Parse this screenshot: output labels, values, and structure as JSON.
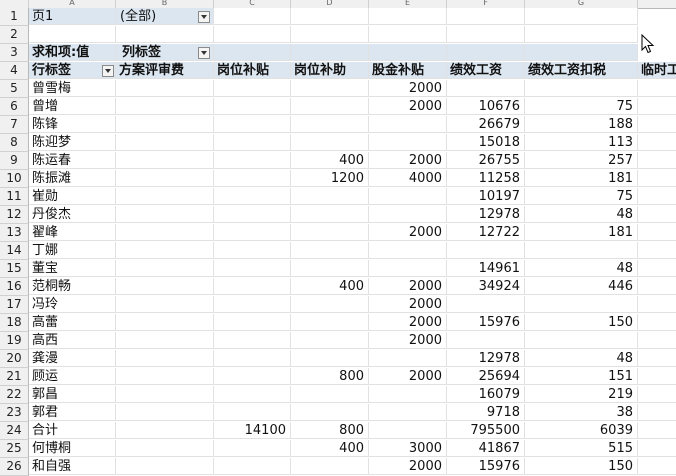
{
  "column_headers": [
    "A",
    "B",
    "C",
    "D",
    "E",
    "F",
    "G"
  ],
  "filter": {
    "field": "页1",
    "value": "(全部)"
  },
  "pivot": {
    "value_label": "求和项:值",
    "column_label": "列标签",
    "row_label": "行标签",
    "columns": [
      "方案评审费",
      "岗位补贴",
      "岗位补助",
      "股金补贴",
      "绩效工资",
      "绩效工资扣税",
      "临时工"
    ]
  },
  "row_numbers": [
    "1",
    "2",
    "3",
    "4",
    "5",
    "6",
    "7",
    "8",
    "9",
    "10",
    "11",
    "12",
    "13",
    "14",
    "15",
    "16",
    "17",
    "18",
    "19",
    "20",
    "21",
    "22",
    "23",
    "24",
    "25",
    "26"
  ],
  "rows": [
    {
      "name": "曾雪梅",
      "v": [
        "",
        "",
        "",
        "2000",
        "",
        "",
        ""
      ]
    },
    {
      "name": "曾增",
      "v": [
        "",
        "",
        "",
        "2000",
        "10676",
        "75",
        ""
      ]
    },
    {
      "name": "陈锋",
      "v": [
        "",
        "",
        "",
        "",
        "26679",
        "188",
        ""
      ]
    },
    {
      "name": "陈迎梦",
      "v": [
        "",
        "",
        "",
        "",
        "15018",
        "113",
        ""
      ]
    },
    {
      "name": "陈运春",
      "v": [
        "",
        "",
        "400",
        "2000",
        "26755",
        "257",
        ""
      ]
    },
    {
      "name": "陈振滩",
      "v": [
        "",
        "",
        "1200",
        "4000",
        "11258",
        "181",
        ""
      ]
    },
    {
      "name": "崔勋",
      "v": [
        "",
        "",
        "",
        "",
        "10197",
        "75",
        ""
      ]
    },
    {
      "name": "丹俊杰",
      "v": [
        "",
        "",
        "",
        "",
        "12978",
        "48",
        ""
      ]
    },
    {
      "name": "翟峰",
      "v": [
        "",
        "",
        "",
        "2000",
        "12722",
        "181",
        ""
      ]
    },
    {
      "name": "丁娜",
      "v": [
        "",
        "",
        "",
        "",
        "",
        "",
        ""
      ]
    },
    {
      "name": "董宝",
      "v": [
        "",
        "",
        "",
        "",
        "14961",
        "48",
        ""
      ]
    },
    {
      "name": "范桐畅",
      "v": [
        "",
        "",
        "400",
        "2000",
        "34924",
        "446",
        ""
      ]
    },
    {
      "name": "冯玲",
      "v": [
        "",
        "",
        "",
        "2000",
        "",
        "",
        ""
      ]
    },
    {
      "name": "高蕾",
      "v": [
        "",
        "",
        "",
        "2000",
        "15976",
        "150",
        ""
      ]
    },
    {
      "name": "高西",
      "v": [
        "",
        "",
        "",
        "2000",
        "",
        "",
        ""
      ]
    },
    {
      "name": "龚漫",
      "v": [
        "",
        "",
        "",
        "",
        "12978",
        "48",
        ""
      ]
    },
    {
      "name": "顾运",
      "v": [
        "",
        "",
        "800",
        "2000",
        "25694",
        "151",
        ""
      ]
    },
    {
      "name": "郭昌",
      "v": [
        "",
        "",
        "",
        "",
        "16079",
        "219",
        ""
      ]
    },
    {
      "name": "郭君",
      "v": [
        "",
        "",
        "",
        "",
        "9718",
        "38",
        ""
      ]
    },
    {
      "name": "合计",
      "v": [
        "",
        "14100",
        "800",
        "",
        "795500",
        "6039",
        ""
      ]
    },
    {
      "name": "何博桐",
      "v": [
        "",
        "",
        "400",
        "3000",
        "41867",
        "515",
        ""
      ]
    },
    {
      "name": "和自强",
      "v": [
        "",
        "",
        "",
        "2000",
        "15976",
        "150",
        ""
      ]
    }
  ]
}
